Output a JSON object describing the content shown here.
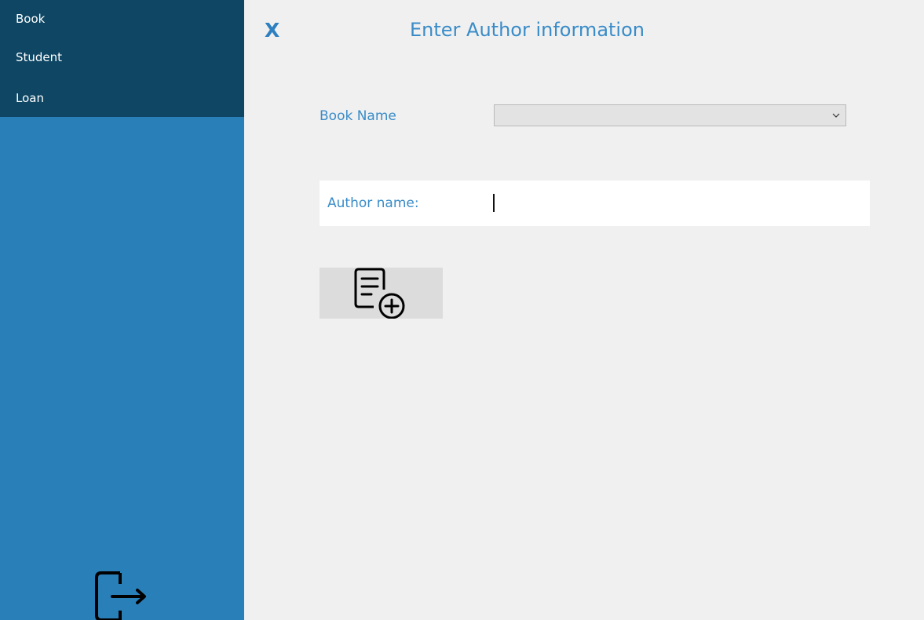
{
  "sidebar": {
    "items": [
      {
        "label": "Book"
      },
      {
        "label": "Student"
      },
      {
        "label": "Loan"
      }
    ],
    "logout_icon": "logout-icon"
  },
  "header": {
    "close_label": "X",
    "title": "Enter Author information"
  },
  "form": {
    "book_name_label": "Book Name",
    "book_name_value": "",
    "author_name_label": "Author name:",
    "author_name_value": "",
    "add_icon": "document-add-icon"
  },
  "colors": {
    "sidebar_dark": "#0e4664",
    "sidebar": "#2980b9",
    "accent_text": "#3a8cc8",
    "background": "#f0f0f0"
  }
}
